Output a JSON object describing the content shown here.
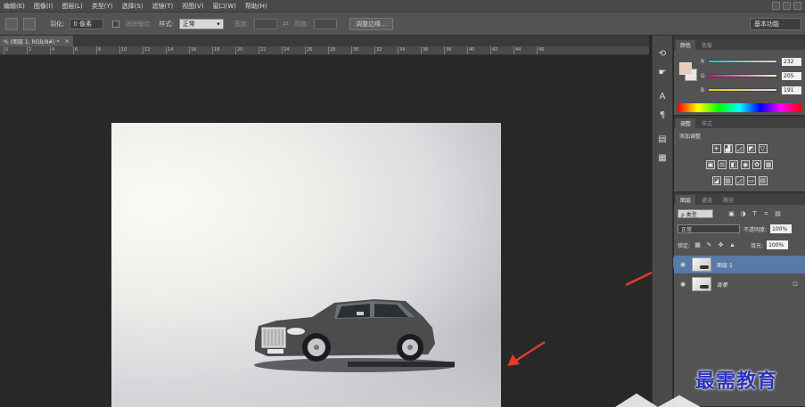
{
  "menu": [
    "编辑(E)",
    "图像(I)",
    "图层(L)",
    "类型(Y)",
    "选择(S)",
    "滤镜(T)",
    "视图(V)",
    "窗口(W)",
    "帮助(H)"
  ],
  "options": {
    "feather_label": "羽化:",
    "feather_value": "0 像素",
    "antialias_label": "消除锯齿",
    "style_label": "样式:",
    "style_value": "正常",
    "width_label": "宽度:",
    "height_label": "高度:",
    "refine_edge_button": "调整边缘...",
    "workspace": "基本功能"
  },
  "document": {
    "tab_title": "% (图层 1, RGB/8#) *",
    "tab_close": "×"
  },
  "ruler_numbers": [
    "0",
    "2",
    "4",
    "6",
    "8",
    "10",
    "12",
    "14",
    "16",
    "18",
    "20",
    "22",
    "24",
    "26",
    "28",
    "30",
    "32",
    "34",
    "36",
    "38",
    "40",
    "42",
    "44",
    "46"
  ],
  "tools": {
    "icons": [
      "history-icon",
      "hand-pointer-icon",
      "type-icon",
      "paragraph-icon",
      "layers-icon",
      "notes-icon"
    ]
  },
  "color_panel": {
    "tabs": [
      "颜色",
      "色板"
    ],
    "r_label": "R",
    "r_value": "232",
    "g_label": "G",
    "g_value": "205",
    "b_label": "B",
    "b_value": "191"
  },
  "adjust_panel": {
    "tabs": [
      "调整",
      "样式"
    ],
    "title": "添加调整"
  },
  "layers_panel": {
    "tabs": [
      "图层",
      "通道",
      "路径"
    ],
    "kind_filter": "ρ 类型",
    "blend_mode": "正常",
    "opacity_label": "不透明度:",
    "opacity_value": "100%",
    "lock_label": "锁定:",
    "fill_label": "填充:",
    "fill_value": "100%",
    "layers": [
      {
        "name": "图层 1",
        "selected": true
      },
      {
        "name": "背景",
        "selected": false
      }
    ]
  },
  "watermark": "最需教育"
}
